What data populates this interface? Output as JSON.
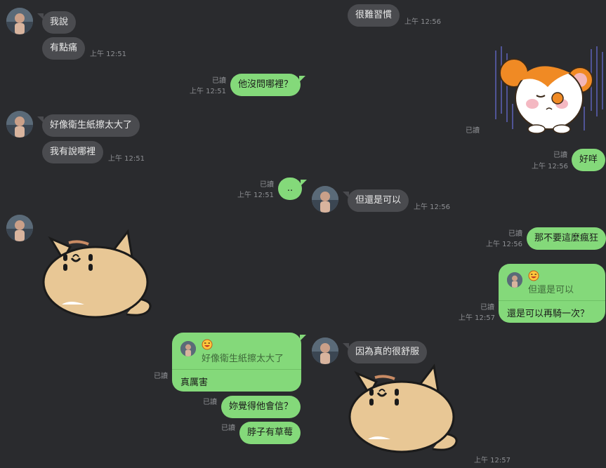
{
  "chat": {
    "left_column": [
      {
        "id": "m1",
        "sender": "other",
        "text": "我說"
      },
      {
        "id": "m2",
        "sender": "other",
        "text": "有點痛",
        "time": "上午 12:51"
      },
      {
        "id": "m3",
        "sender": "me",
        "text": "他沒問哪裡？",
        "read": "已讀",
        "time": "上午 12:51"
      },
      {
        "id": "m4",
        "sender": "other",
        "text": "好像衛生紙擦太大了"
      },
      {
        "id": "m5",
        "sender": "other",
        "text": "我有說哪裡",
        "time": "上午 12:51"
      },
      {
        "id": "m6",
        "sender": "me",
        "text": "..",
        "read": "已讀",
        "time": "上午 12:51"
      },
      {
        "id": "m7",
        "sender": "other",
        "type": "sticker",
        "sticker": "cat-sticker"
      },
      {
        "id": "m8",
        "sender": "me",
        "type": "reply",
        "quote_emoji": "grinning-face-icon",
        "quote_text": "好像衛生紙擦太大了",
        "text": "真厲害",
        "read": "已讀"
      },
      {
        "id": "m9",
        "sender": "me",
        "text": "妳覺得他會信？",
        "read": "已讀"
      },
      {
        "id": "m10",
        "sender": "me",
        "text": "脖子有草莓",
        "read": "已讀"
      }
    ],
    "right_column": [
      {
        "id": "r1",
        "sender": "other",
        "text": "很難習慣",
        "time": "上午 12:56"
      },
      {
        "id": "r2",
        "sender": "me",
        "type": "sticker",
        "sticker": "hamster-sticker",
        "read": "已讀"
      },
      {
        "id": "r3",
        "sender": "me",
        "text": "好咩",
        "read": "已讀",
        "time": "上午 12:56"
      },
      {
        "id": "r4",
        "sender": "other",
        "text": "但還是可以",
        "time": "上午 12:56"
      },
      {
        "id": "r5",
        "sender": "me",
        "text": "那不要這麼瘋狂",
        "read": "已讀",
        "time": "上午 12:56"
      },
      {
        "id": "r6",
        "sender": "me",
        "type": "reply",
        "quote_emoji": "grinning-face-icon",
        "quote_text": "但還是可以",
        "text": "還是可以再騎一次？",
        "read": "已讀",
        "time": "上午 12:57"
      },
      {
        "id": "r7",
        "sender": "other",
        "text": "因為真的很舒服"
      },
      {
        "id": "r8",
        "sender": "other",
        "type": "sticker",
        "sticker": "cat-sticker",
        "time": "上午 12:57"
      }
    ]
  },
  "colors": {
    "background": "#2a2b2e",
    "bubble_other": "#4a4b4f",
    "bubble_me": "#84d97a",
    "meta_text": "#8d8f93"
  }
}
